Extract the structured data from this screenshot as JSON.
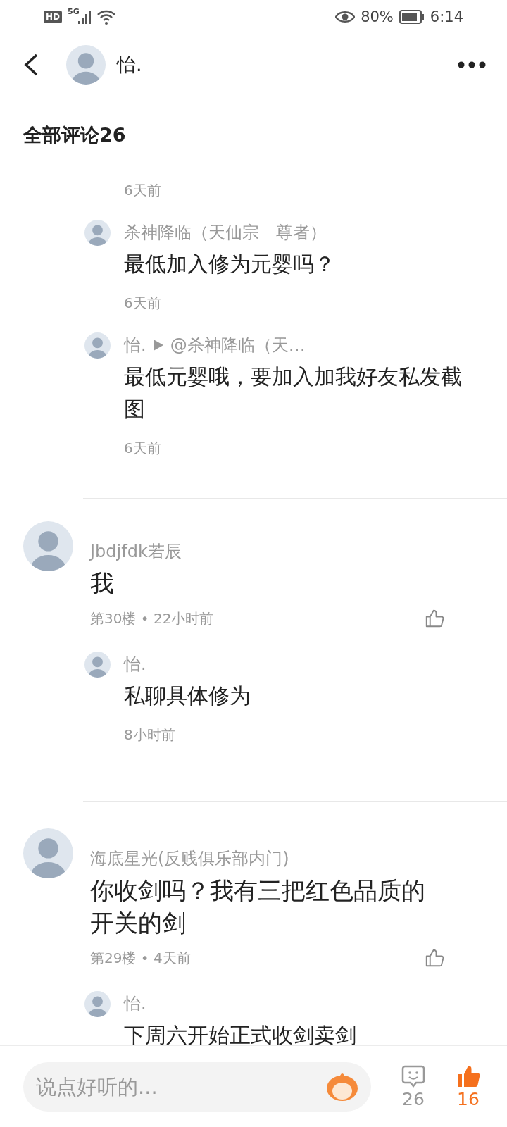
{
  "status_bar": {
    "hd": "HD",
    "network": "5G",
    "battery": "80%",
    "time": "6:14"
  },
  "header": {
    "name": "怡."
  },
  "section_title": "全部评论26",
  "comments": [
    {
      "replies": [
        {
          "time": "6天前"
        },
        {
          "author": "杀神降临（天仙宗　尊者）",
          "text": "最低加入修为元婴吗？",
          "time": "6天前"
        },
        {
          "author": "怡.",
          "target": "@杀神降临（天…",
          "text": "最低元婴哦，要加入加我好友私发截图",
          "time": "6天前"
        }
      ]
    },
    {
      "author": "Jbdjfdk若辰",
      "text": "我",
      "meta": "第30楼 • 22小时前",
      "liked": false,
      "replies": [
        {
          "author": "怡.",
          "text": "私聊具体修为",
          "time": "8小时前"
        }
      ]
    },
    {
      "author": "海底星光(反贱俱乐部内门)",
      "text": "你收剑吗？我有三把红色品质的开关的剑",
      "meta": "第29楼 • 4天前",
      "liked": false,
      "replies": [
        {
          "author": "怡.",
          "text": "下周六开始正式收剑卖剑"
        }
      ]
    }
  ],
  "bottom_bar": {
    "placeholder": "说点好听的...",
    "comment_count": "26",
    "like_count": "16",
    "liked": true
  }
}
